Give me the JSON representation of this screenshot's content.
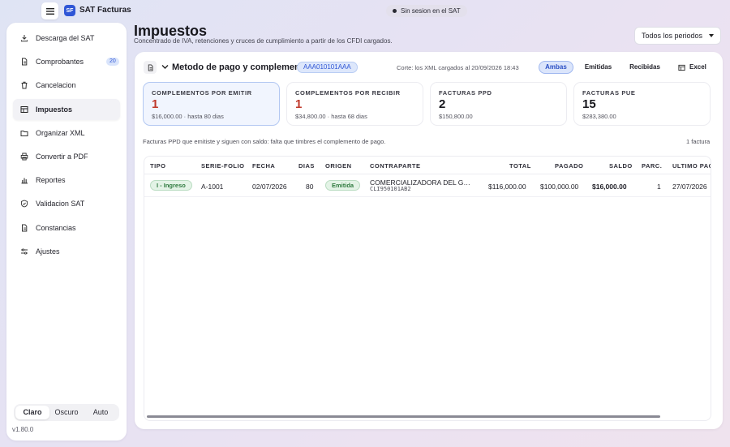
{
  "titlebar": {
    "app_logo": "SF",
    "app_name": "SAT Facturas",
    "session_status": "Sin sesion en el SAT"
  },
  "sidebar": {
    "items": [
      {
        "label": "Descarga del SAT",
        "icon": "download-icon"
      },
      {
        "label": "Comprobantes",
        "icon": "file-icon",
        "badge": "20"
      },
      {
        "label": "Cancelacion",
        "icon": "trash-icon"
      },
      {
        "label": "Impuestos",
        "icon": "table-icon",
        "active": true
      },
      {
        "label": "Organizar XML",
        "icon": "folder-icon"
      },
      {
        "label": "Convertir a PDF",
        "icon": "printer-icon"
      },
      {
        "label": "Reportes",
        "icon": "bar-chart-icon"
      },
      {
        "label": "Validacion SAT",
        "icon": "shield-check-icon"
      },
      {
        "label": "Constancias",
        "icon": "file-icon"
      },
      {
        "label": "Ajustes",
        "icon": "sliders-icon"
      }
    ],
    "theme": {
      "options": [
        "Claro",
        "Oscuro",
        "Auto"
      ],
      "selected": "Claro"
    },
    "version": "v1.80.0"
  },
  "header": {
    "title": "Impuestos",
    "subtitle": "Concentrado de IVA, retenciones y cruces de cumplimiento a partir de los CFDI cargados.",
    "period_select": "Todos los periodos"
  },
  "section": {
    "title": "Metodo de pago y complementos",
    "rfc": "AAA010101AAA",
    "cut": "Corte: los XML cargados al 20/09/2026 18:43",
    "filters": [
      "Ambas",
      "Emitidas",
      "Recibidas"
    ],
    "active_filter": "Ambas",
    "excel_label": "Excel"
  },
  "stats": [
    {
      "label": "COMPLEMENTOS POR EMITIR",
      "value": "1",
      "sub": "$16,000.00 · hasta 80 dias"
    },
    {
      "label": "COMPLEMENTOS POR RECIBIR",
      "value": "1",
      "sub": "$34,800.00 · hasta 68 dias"
    },
    {
      "label": "FACTURAS PPD",
      "value": "2",
      "sub": "$150,800.00"
    },
    {
      "label": "FACTURAS PUE",
      "value": "15",
      "sub": "$283,380.00"
    }
  ],
  "notes": {
    "ppd": "Facturas PPD que emitiste y siguen con saldo: falta que timbres el complemento de pago.",
    "count": "1 factura"
  },
  "table": {
    "headers": [
      "TIPO",
      "SERIE-FOLIO",
      "FECHA",
      "DIAS",
      "ORIGEN",
      "CONTRAPARTE",
      "TOTAL",
      "PAGADO",
      "SALDO",
      "PARC.",
      "ULTIMO PAG"
    ],
    "rows": [
      {
        "tipo": "I - Ingreso",
        "serie_folio": "A-1001",
        "fecha": "02/07/2026",
        "dias": "80",
        "origen": "Emitida",
        "contraparte": "COMERCIALIZADORA DEL GOLFO",
        "contraparte_rfc": "CLI950101AB2",
        "total": "$116,000.00",
        "pagado": "$100,000.00",
        "saldo": "$16,000.00",
        "parc": "1",
        "ultimo_pago": "27/07/2026"
      }
    ]
  },
  "colors": {
    "accent": "#2f56d6",
    "danger": "#c0392b",
    "success": "#2f7a3f"
  }
}
